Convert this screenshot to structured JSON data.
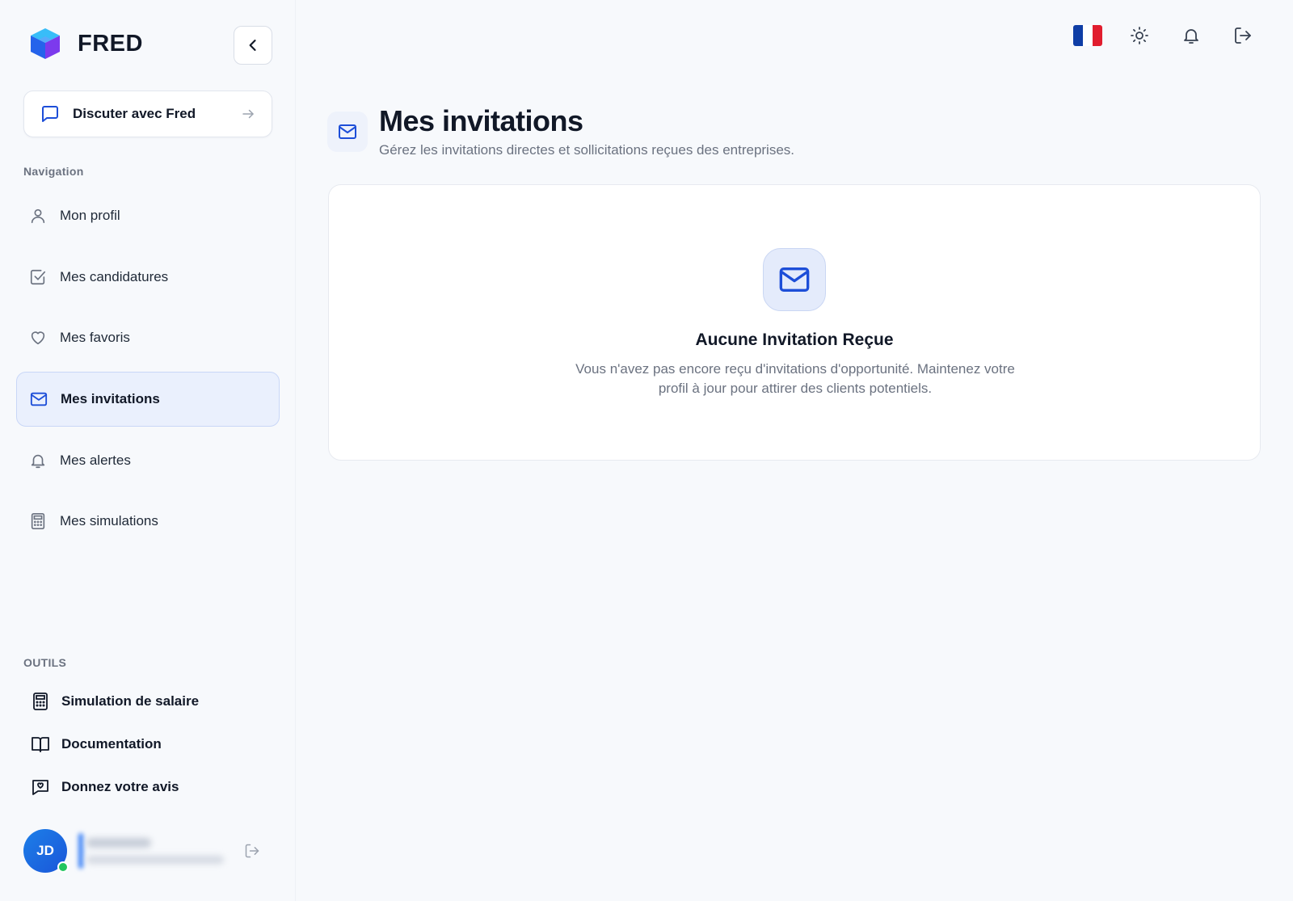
{
  "brand": {
    "name": "FRED"
  },
  "chat_button": {
    "label": "Discuter avec Fred"
  },
  "navigation": {
    "title": "Navigation",
    "items": [
      {
        "label": "Mon profil",
        "icon": "user-icon",
        "active": false
      },
      {
        "label": "Mes candidatures",
        "icon": "checkbox-icon",
        "active": false
      },
      {
        "label": "Mes favoris",
        "icon": "heart-icon",
        "active": false
      },
      {
        "label": "Mes invitations",
        "icon": "mail-icon",
        "active": true
      },
      {
        "label": "Mes alertes",
        "icon": "bell-icon",
        "active": false
      },
      {
        "label": "Mes simulations",
        "icon": "calculator-icon",
        "active": false
      }
    ]
  },
  "tools": {
    "title": "OUTILS",
    "items": [
      {
        "label": "Simulation de salaire",
        "icon": "calculator-icon"
      },
      {
        "label": "Documentation",
        "icon": "book-icon"
      },
      {
        "label": "Donnez votre avis",
        "icon": "feedback-icon"
      }
    ]
  },
  "user": {
    "initials": "JD"
  },
  "topbar": {
    "language": "FR"
  },
  "page": {
    "title": "Mes invitations",
    "subtitle": "Gérez les invitations directes et sollicitations reçues des entreprises."
  },
  "empty_state": {
    "title": "Aucune Invitation Reçue",
    "description": "Vous n'avez pas encore reçu d'invitations d'opportunité. Maintenez votre profil à jour pour attirer des clients potentiels."
  },
  "colors": {
    "accent": "#1d4ed8",
    "active_bg": "#eaf0fd",
    "flag_blue": "#0f3ea6",
    "flag_red": "#e11d2e"
  }
}
